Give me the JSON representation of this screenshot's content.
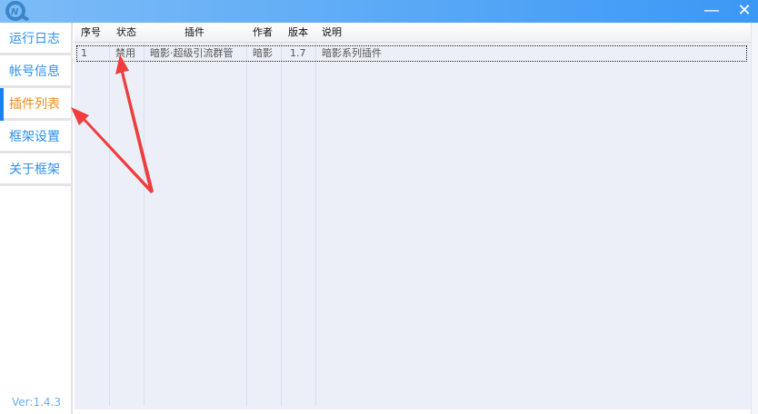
{
  "window": {
    "minimize": "—",
    "close": "✕",
    "logo_icon": "qq-logo-icon"
  },
  "sidebar": {
    "items": [
      {
        "label": "运行日志"
      },
      {
        "label": "帐号信息"
      },
      {
        "label": "插件列表"
      },
      {
        "label": "框架设置"
      },
      {
        "label": "关于框架"
      }
    ],
    "active": 2,
    "version": "Ver:1.4.3"
  },
  "table": {
    "headers": [
      "序号",
      "状态",
      "插件",
      "作者",
      "版本",
      "说明"
    ],
    "rows": [
      [
        "1",
        "禁用",
        "暗影·超级引流群管",
        "暗影",
        "1.7",
        "暗影系列插件"
      ]
    ]
  },
  "annotation_color": "#f03c3c"
}
